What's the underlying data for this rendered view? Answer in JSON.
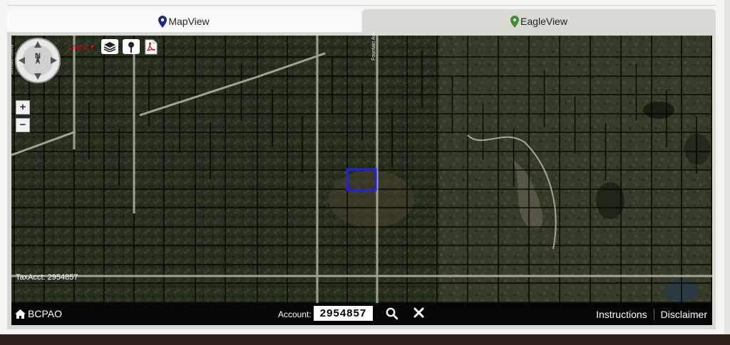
{
  "tabs": [
    {
      "label": "MapView",
      "pin_color": "#1a2a8c"
    },
    {
      "label": "EagleView",
      "pin_color": "#3a8f2e"
    }
  ],
  "map": {
    "latest_label": "Latest",
    "tax_label": "TaxAcct: 2954857",
    "road_label": "Fountain Ave",
    "side_label": "Brevard County",
    "highlight_color": "#1e22e6"
  },
  "footer": {
    "home_label": "BCPAO",
    "account_label": "Account:",
    "account_value": "2954857",
    "links": [
      "Instructions",
      "Disclaimer"
    ]
  },
  "colors": {
    "frame": "#d9d9d4",
    "footer": "#060606",
    "accent_red": "#c8181e"
  }
}
